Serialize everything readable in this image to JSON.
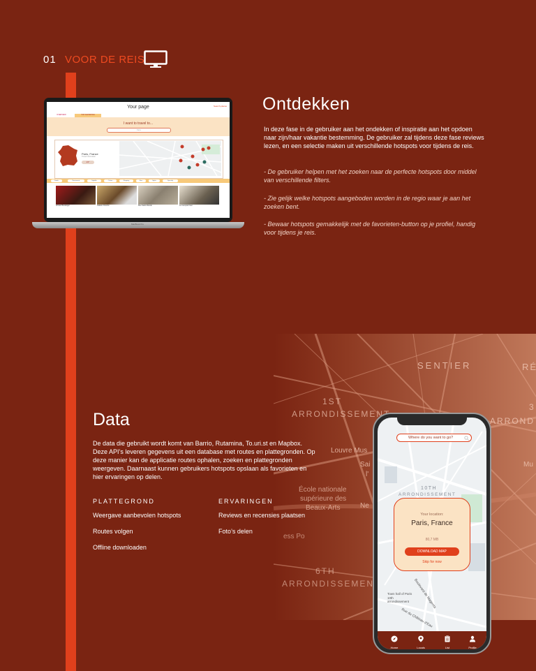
{
  "section": {
    "number": "01",
    "title": "VOOR DE REIS",
    "icon": "monitor-icon"
  },
  "laptop_screen": {
    "page_title": "Your page",
    "search_button": "Search places",
    "tabs": [
      "OVERVIEW",
      "TOP FAVORITES"
    ],
    "hero_text": "I want to travel to...",
    "search_placeholder": "Paris",
    "city": "Paris, France",
    "city_sub": "Travel Information",
    "badge": "21°",
    "filters": [
      "Foods",
      "Restaurants",
      "Nightlife",
      "Culture",
      "Shopping",
      "Bars",
      "Sights",
      "Specialty"
    ],
    "places": [
      "Artisan Boulanger",
      "Galerie Cinema",
      "Rue Saint-Claude",
      "Le Comptoir Gen"
    ],
    "brand": "MacBook Pro"
  },
  "ontdekken": {
    "title": "Ontdekken",
    "intro": "In deze fase in de gebruiker aan het ondekken of inspiratie aan het opdoen naar zijn/haar vakantie bestemming. De gebruiker zal tijdens deze fase reviews lezen, en een selectie maken uit verschillende hotspots voor tijdens de reis.",
    "bullets": [
      "- De gebruiker helpen met het zoeken naar de perfecte hotspots door middel van verschillende filters.",
      "- Zie gelijk welke hotspots aangeboden worden in de regio waar je aan het zoeken bent.",
      "- Bewaar hotspots gemakkelijk met de favorieten-button op je profiel, handig voor tijdens je reis."
    ]
  },
  "map_labels": {
    "sentier": "SENTIER",
    "re": "RÉ",
    "arr1_a": "1ST",
    "arr1_b": "ARRONDISSEMENT",
    "arr_right": "ARROND",
    "three": "3",
    "louvre": "Louvre Mus",
    "mu": "Mu",
    "sai": "Sai",
    "l": "l'",
    "ecole_a": "École nationale",
    "ecole_b": "supérieure des",
    "ecole_c": "Beaux-Arts",
    "ne": "Ne",
    "ess": "ess Po",
    "arr6_a": "6TH",
    "arr6_b": "ARRONDISSEMENT"
  },
  "data": {
    "title": "Data",
    "body": "De data die gebruikt wordt komt van  Barrio, Rutamina, To.uri.st en Mapbox. Deze API’s leveren gegevens uit een database met routes en plattegronden. Op deze manier kan de applicatie routes ophalen, zoeken en plattegronden weergeven. Daarnaast kunnen gebruikers hotspots opslaan als favorieten en hier ervaringen op delen.",
    "columns": [
      {
        "heading": "PLATTEGROND",
        "items": [
          "Weergave aanbevolen hotspots",
          "Routes volgen",
          "Offline downloaden"
        ]
      },
      {
        "heading": "ERVARINGEN",
        "items": [
          "Reviews en recensies plaatsen",
          "Foto’s delen"
        ]
      }
    ]
  },
  "phone": {
    "search_placeholder": "Where do you want to go?",
    "map_label_10th_a": "10TH",
    "map_label_10th_b": "ARRONDISSEMENT",
    "your_location": "Your location:",
    "location": "Paris, France",
    "size": "80,7 MB",
    "download_button": "DOWNLOAD MAP",
    "skip_link": "Skip for now",
    "town_hall": "Town hall of Paris 10th arrondissement",
    "street1": "Boulevard de Magenta",
    "street2": "Rue du Château d'Eau",
    "nav": [
      "Home",
      "Locals",
      "List",
      "Profile"
    ]
  },
  "colors": {
    "background": "#7a2412",
    "accent": "#e0401c",
    "card": "#fbe3c4"
  }
}
